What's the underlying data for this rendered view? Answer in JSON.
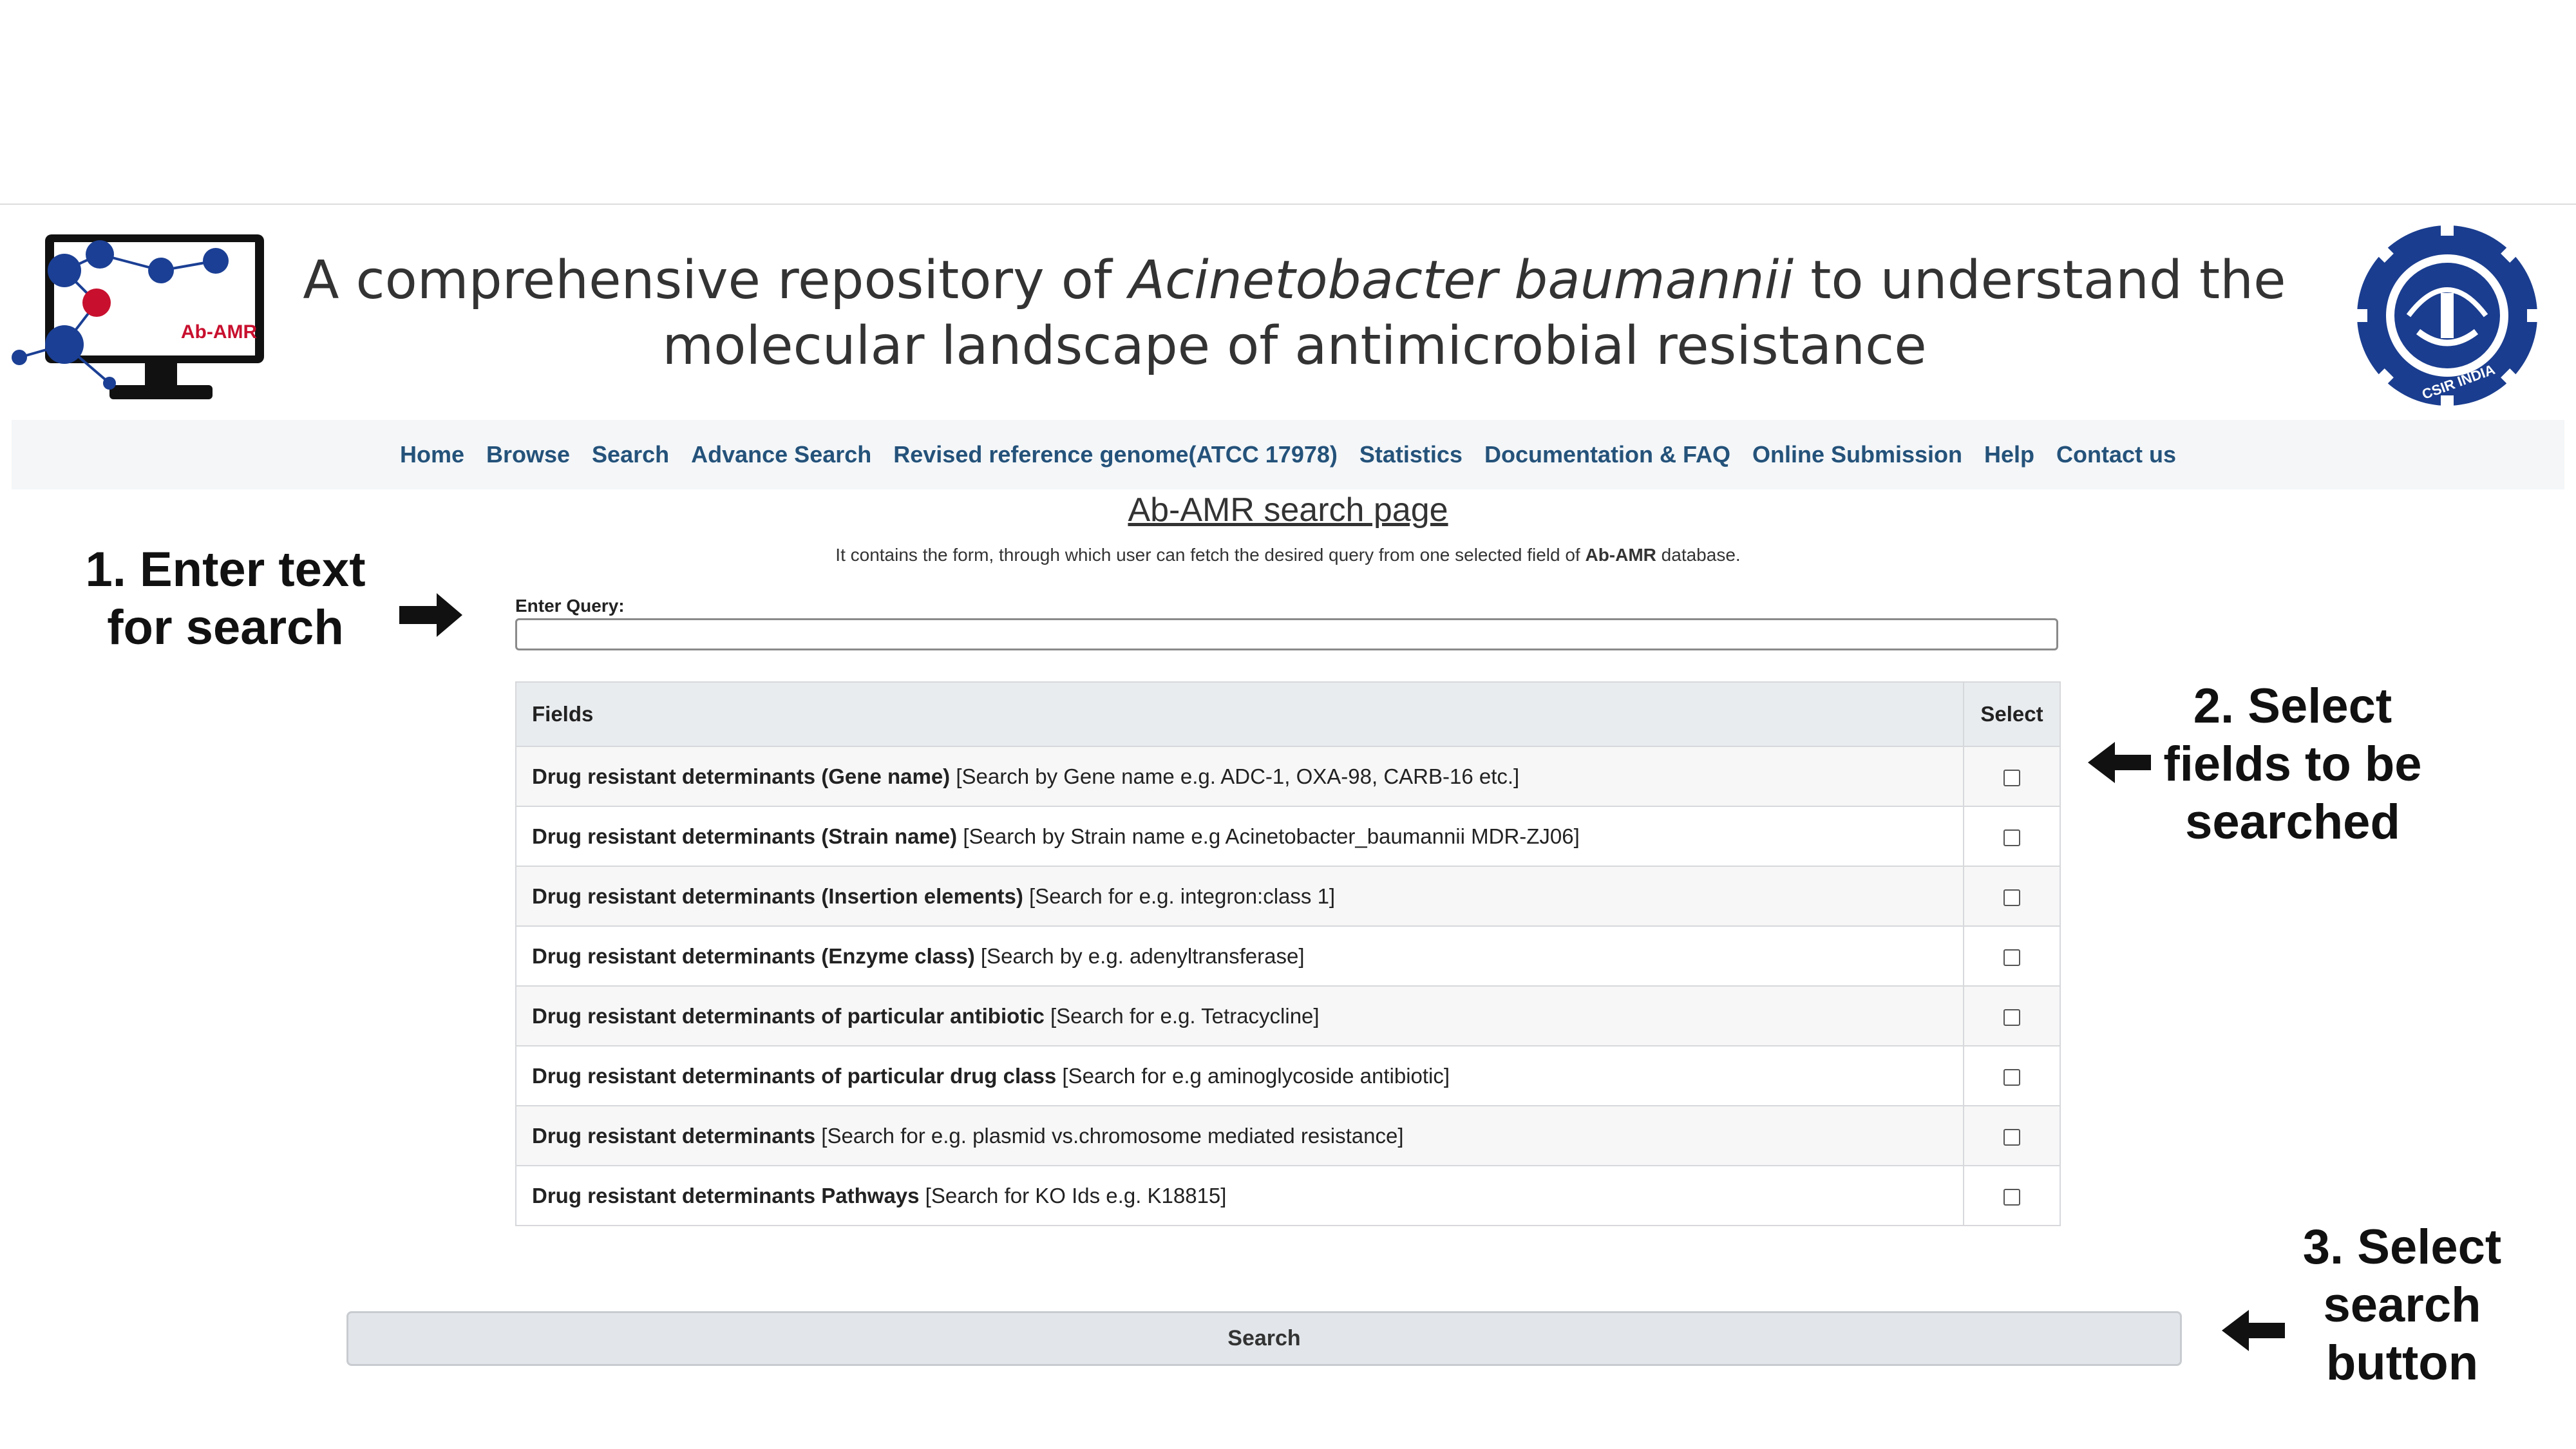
{
  "header": {
    "title_before": "A comprehensive repository of ",
    "title_italic": "Acinetobacter baumannii",
    "title_after": " to understand the molecular landscape of antimicrobial resistance",
    "logo_text": "Ab-AMR",
    "emblem_text": "CSIR INDIA"
  },
  "nav": {
    "items": [
      "Home",
      "Browse",
      "Search",
      "Advance Search",
      "Revised reference genome(ATCC 17978)",
      "Statistics",
      "Documentation & FAQ",
      "Online Submission",
      "Help",
      "Contact us"
    ]
  },
  "page": {
    "heading": "Ab-AMR search page",
    "desc_before": "It contains the form, through which user can fetch the desired query from one selected field of ",
    "desc_bold": "Ab-AMR",
    "desc_after": " database."
  },
  "form": {
    "query_label": "Enter Query:",
    "query_value": "",
    "table_headers": {
      "fields": "Fields",
      "select": "Select"
    },
    "rows": [
      {
        "bold": "Drug resistant determinants (Gene name)",
        "hint": " [Search by Gene name e.g. ADC-1, OXA-98, CARB-16 etc.]",
        "checked": false
      },
      {
        "bold": "Drug resistant determinants (Strain name)",
        "hint": " [Search by Strain name e.g Acinetobacter_baumannii MDR-ZJ06]",
        "checked": false
      },
      {
        "bold": "Drug resistant determinants (Insertion elements)",
        "hint": " [Search for e.g. integron:class 1]",
        "checked": false
      },
      {
        "bold": "Drug resistant determinants (Enzyme class)",
        "hint": " [Search by e.g. adenyltransferase]",
        "checked": false
      },
      {
        "bold": "Drug resistant determinants of particular antibiotic",
        "hint": " [Search for e.g. Tetracycline]",
        "checked": false
      },
      {
        "bold": "Drug resistant determinants of particular drug class",
        "hint": " [Search for e.g aminoglycoside antibiotic]",
        "checked": false
      },
      {
        "bold": "Drug resistant determinants",
        "hint": " [Search for e.g. plasmid vs.chromosome mediated resistance]",
        "checked": false
      },
      {
        "bold": "Drug resistant determinants Pathways",
        "hint": " [Search for KO Ids e.g. K18815]",
        "checked": false
      }
    ],
    "search_label": "Search"
  },
  "annotations": {
    "step1": [
      "1. Enter text",
      "for search"
    ],
    "step2": [
      "2. Select",
      "fields to be",
      "searched"
    ],
    "step3": [
      "3. Select",
      "search",
      "button"
    ]
  },
  "colors": {
    "nav_link": "#24527a",
    "navbar_bg": "#f4f6f8",
    "table_header_bg": "#e9ecef",
    "button_bg": "#e2e6ea",
    "logo_blue": "#1b3f94",
    "logo_red": "#c8102e"
  }
}
